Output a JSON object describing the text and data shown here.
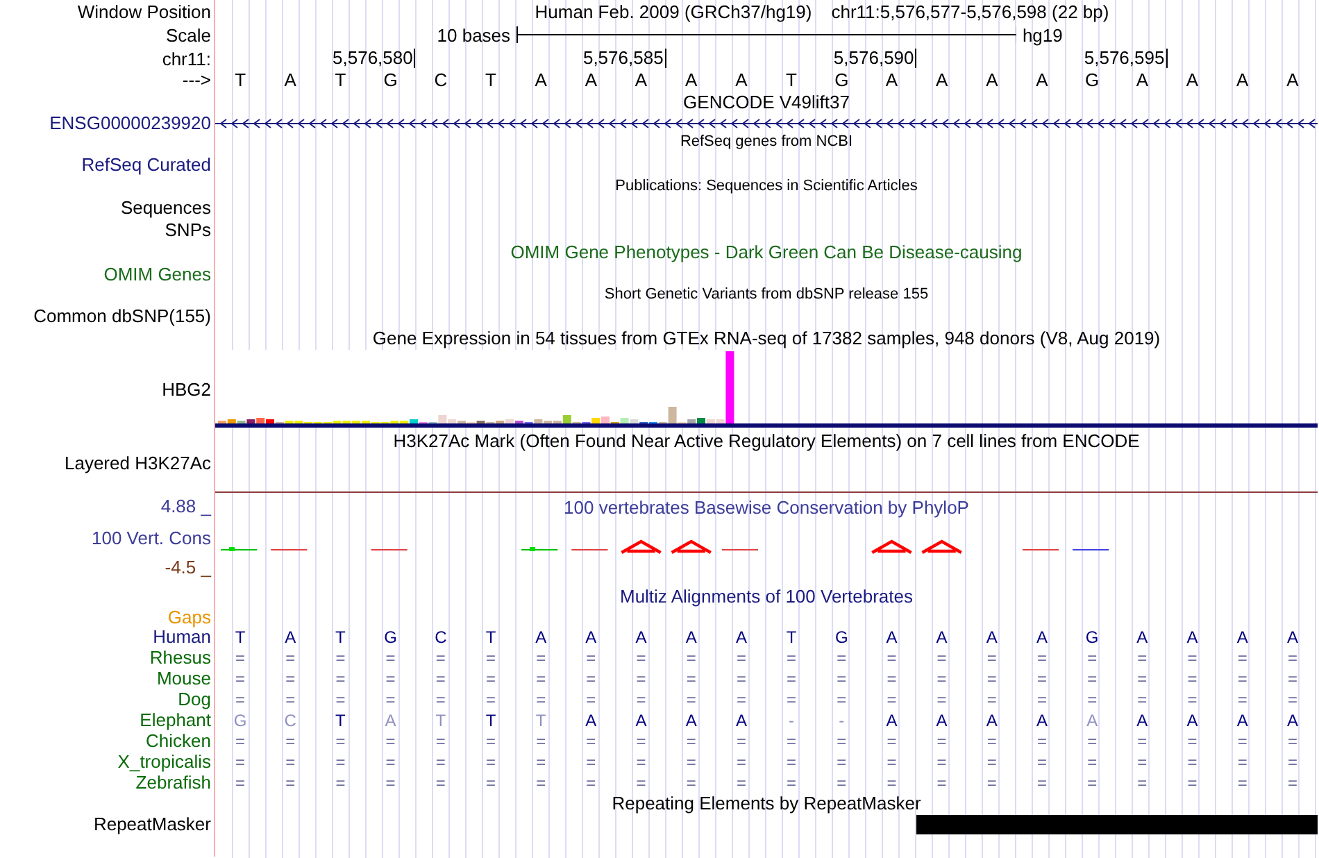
{
  "header": {
    "position_label": "Window Position",
    "assembly": "Human Feb. 2009 (GRCh37/hg19)",
    "range": "chr11:5,576,577-5,576,598 (22 bp)"
  },
  "scale": {
    "label": "Scale",
    "span": "10 bases",
    "assembly": "hg19"
  },
  "coordinates": {
    "label": "chr11:",
    "ticks": [
      "5,576,580",
      "5,576,585",
      "5,576,590",
      "5,576,595"
    ]
  },
  "sequence": {
    "label": "--->",
    "bases": [
      "T",
      "A",
      "T",
      "G",
      "C",
      "T",
      "A",
      "A",
      "A",
      "A",
      "A",
      "T",
      "G",
      "A",
      "A",
      "A",
      "A",
      "G",
      "A",
      "A",
      "A",
      "A"
    ]
  },
  "gencode": {
    "title": "GENCODE V49lift37",
    "gene": "ENSG00000239920"
  },
  "refseq": {
    "title": "RefSeq genes from NCBI",
    "label": "RefSeq Curated"
  },
  "publications": {
    "title": "Publications: Sequences in Scientific Articles",
    "labels": [
      "Sequences",
      "SNPs"
    ]
  },
  "omim": {
    "title": "OMIM Gene Phenotypes - Dark Green Can Be Disease-causing",
    "label": "OMIM Genes"
  },
  "dbsnp": {
    "title": "Short Genetic Variants from dbSNP release 155",
    "label": "Common dbSNP(155)"
  },
  "gtex": {
    "title": "Gene Expression in 54 tissues from GTEx RNA-seq of 17382 samples, 948 donors (V8, Aug 2019)",
    "label": "HBG2"
  },
  "h3k27ac": {
    "title": "H3K27Ac Mark (Often Found Near Active Regulatory Elements) on 7 cell lines from ENCODE",
    "label": "Layered H3K27Ac"
  },
  "conservation": {
    "title": "100 vertebrates Basewise Conservation by PhyloP",
    "label": "100 Vert. Cons",
    "max": "4.88 _",
    "min": "-4.5 _"
  },
  "multiz": {
    "title": "Multiz Alignments of 100 Vertebrates",
    "gaps_label": "Gaps",
    "species": [
      {
        "name": "Human",
        "kind": "reference",
        "bases": [
          "T",
          "A",
          "T",
          "G",
          "C",
          "T",
          "A",
          "A",
          "A",
          "A",
          "A",
          "T",
          "G",
          "A",
          "A",
          "A",
          "A",
          "G",
          "A",
          "A",
          "A",
          "A"
        ]
      },
      {
        "name": "Rhesus",
        "kind": "aligned",
        "bases": [
          "=",
          "=",
          "=",
          "=",
          "=",
          "=",
          "=",
          "=",
          "=",
          "=",
          "=",
          "=",
          "=",
          "=",
          "=",
          "=",
          "=",
          "=",
          "=",
          "=",
          "=",
          "="
        ]
      },
      {
        "name": "Mouse",
        "kind": "aligned",
        "bases": [
          "=",
          "=",
          "=",
          "=",
          "=",
          "=",
          "=",
          "=",
          "=",
          "=",
          "=",
          "=",
          "=",
          "=",
          "=",
          "=",
          "=",
          "=",
          "=",
          "=",
          "=",
          "="
        ]
      },
      {
        "name": "Dog",
        "kind": "aligned",
        "bases": [
          "=",
          "=",
          "=",
          "=",
          "=",
          "=",
          "=",
          "=",
          "=",
          "=",
          "=",
          "=",
          "=",
          "=",
          "=",
          "=",
          "=",
          "=",
          "=",
          "=",
          "=",
          "="
        ]
      },
      {
        "name": "Elephant",
        "kind": "aligned",
        "bases": [
          "G",
          "C",
          "T",
          "A",
          "T",
          "T",
          "T",
          "A",
          "A",
          "A",
          "A",
          "-",
          "-",
          "A",
          "A",
          "A",
          "A",
          "A",
          "A",
          "A",
          "A",
          "A"
        ],
        "dimmed": [
          true,
          true,
          false,
          true,
          true,
          false,
          true,
          false,
          false,
          false,
          false,
          true,
          true,
          false,
          false,
          false,
          false,
          true,
          false,
          false,
          false,
          false
        ]
      },
      {
        "name": "Chicken",
        "kind": "aligned",
        "bases": [
          "=",
          "=",
          "=",
          "=",
          "=",
          "=",
          "=",
          "=",
          "=",
          "=",
          "=",
          "=",
          "=",
          "=",
          "=",
          "=",
          "=",
          "=",
          "=",
          "=",
          "=",
          "="
        ]
      },
      {
        "name": "X_tropicalis",
        "kind": "aligned",
        "bases": [
          "=",
          "=",
          "=",
          "=",
          "=",
          "=",
          "=",
          "=",
          "=",
          "=",
          "=",
          "=",
          "=",
          "=",
          "=",
          "=",
          "=",
          "=",
          "=",
          "=",
          "=",
          "="
        ]
      },
      {
        "name": "Zebrafish",
        "kind": "aligned",
        "bases": [
          "=",
          "=",
          "=",
          "=",
          "=",
          "=",
          "=",
          "=",
          "=",
          "=",
          "=",
          "=",
          "=",
          "=",
          "=",
          "=",
          "=",
          "=",
          "=",
          "=",
          "=",
          "="
        ]
      }
    ]
  },
  "repeatmasker": {
    "title": "Repeating Elements by RepeatMasker",
    "label": "RepeatMasker"
  }
}
